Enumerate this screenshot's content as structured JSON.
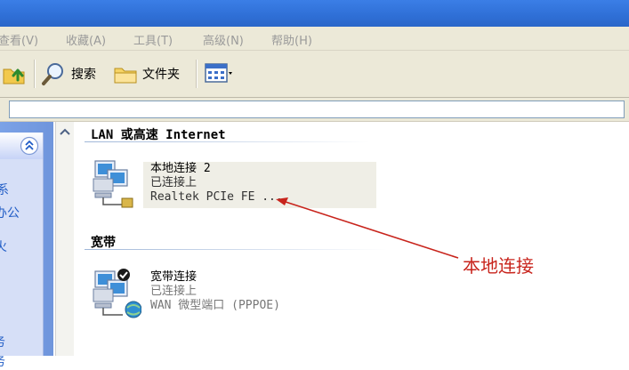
{
  "menu": {
    "view": "查看(V)",
    "favorites": "收藏(A)",
    "tools": "工具(T)",
    "advanced": "高级(N)",
    "help": "帮助(H)"
  },
  "toolbar": {
    "search": "搜索",
    "folders": "文件夹"
  },
  "left_panel": {
    "labels": [
      "系",
      "办公",
      "火",
      "务",
      "务"
    ]
  },
  "groups": {
    "lan": {
      "title": "LAN 或高速 Internet",
      "connection": {
        "name": "本地连接 2",
        "status": "已连接上",
        "device": "Realtek PCIe FE ..."
      }
    },
    "broadband": {
      "title": "宽带",
      "connection": {
        "name": "宽带连接",
        "status": "已连接上",
        "device": "WAN 微型端口 (PPPOE)"
      }
    }
  },
  "annotation": {
    "label": "本地连接",
    "color": "#c8241c"
  },
  "colors": {
    "titlebar": "#2f6fd6",
    "chrome": "#ece9d8",
    "task_pane": "#d6dff7"
  }
}
